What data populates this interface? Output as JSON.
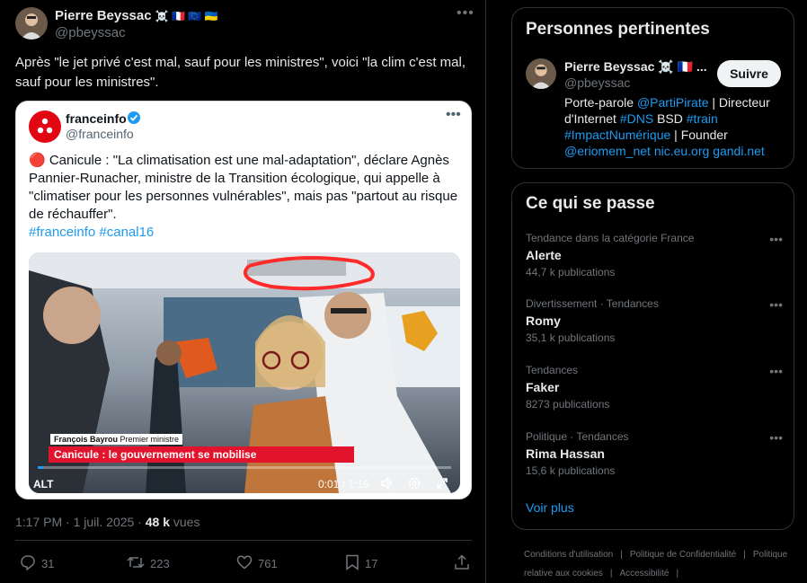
{
  "tweet": {
    "author_name": "Pierre Beyssac",
    "author_emojis": "☠️ 🇫🇷 🇪🇺 🇺🇦",
    "author_handle": "@pbeyssac",
    "text": "Après \"le jet privé c'est mal, sauf pour les ministres\", voici \"la clim c'est mal, sauf pour les ministres\".",
    "time": "1:17 PM · 1 juil. 2025 · ",
    "views_count": "48 k",
    "views_label": " vues",
    "actions": {
      "replies": "31",
      "reposts": "223",
      "likes": "761",
      "bookmarks": "17"
    }
  },
  "quote": {
    "name": "franceinfo",
    "handle": "@franceinfo",
    "text": "🔴 Canicule : \"La climatisation est une mal-adaptation\", déclare Agnès Pannier-Runacher, ministre de la Transition écologique, qui appelle à \"climatiser pour les personnes vulnérables\", mais pas \"partout au risque de réchauffer\".",
    "hashtags": "#franceinfo #canal16",
    "video": {
      "lower_third_name": "François Bayrou",
      "lower_third_role": " Premier ministre",
      "lower_third_title": "Canicule : le gouvernement se mobilise",
      "alt_badge": "ALT",
      "timecode": "0:01 / 1:16",
      "progress": 0.012
    }
  },
  "right": {
    "people_title": "Personnes pertinentes",
    "person": {
      "name": "Pierre Beyssac ☠️ 🇫🇷 ...",
      "handle": "@pbeyssac",
      "follow_label": "Suivre",
      "bio_parts": [
        {
          "t": "Porte-parole ",
          "link": false
        },
        {
          "t": "@PartiPirate",
          "link": true
        },
        {
          "t": " | Directeur d'Internet ",
          "link": false
        },
        {
          "t": "#DNS",
          "link": true
        },
        {
          "t": " BSD ",
          "link": false
        },
        {
          "t": "#train",
          "link": true
        },
        {
          "t": " ",
          "link": false
        },
        {
          "t": "#ImpactNumérique",
          "link": true
        },
        {
          "t": " | Founder ",
          "link": false
        },
        {
          "t": "@eriomem_net",
          "link": true
        },
        {
          "t": " ",
          "link": false
        },
        {
          "t": "nic.eu.org",
          "link": true
        },
        {
          "t": " ",
          "link": false
        },
        {
          "t": "gandi.net",
          "link": true
        }
      ]
    },
    "trends_title": "Ce qui se passe",
    "trends": [
      {
        "category": "Tendance dans la catégorie France",
        "name": "Alerte",
        "count": "44,7 k publications"
      },
      {
        "category": "Divertissement · Tendances",
        "name": "Romy",
        "count": "35,1 k publications"
      },
      {
        "category": "Tendances",
        "name": "Faker",
        "count": "8273 publications"
      },
      {
        "category": "Politique · Tendances",
        "name": "Rima Hassan",
        "count": "15,6 k publications"
      }
    ],
    "see_more": "Voir plus",
    "footer_links": [
      "Conditions d'utilisation",
      "|",
      "Politique de Confidentialité",
      "|",
      "Politique relative aux cookies",
      "|",
      "Accessibilité",
      "|"
    ]
  },
  "colors": {
    "accent": "#1d9bf0",
    "background": "#000000",
    "franceinfo_red": "#e20613",
    "annotation_red": "#ff2a2a"
  },
  "icons": [
    "more-icon",
    "verified-icon",
    "reply-icon",
    "repost-icon",
    "like-icon",
    "bookmark-icon",
    "share-icon",
    "volume-icon",
    "settings-icon",
    "fullscreen-icon"
  ]
}
